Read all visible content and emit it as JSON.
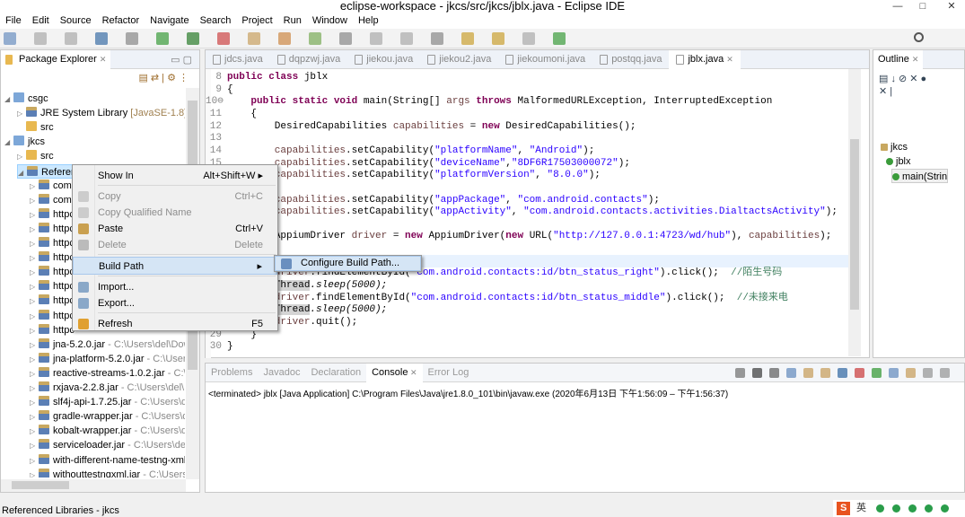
{
  "window": {
    "title": "eclipse-workspace - jkcs/src/jkcs/jblx.java - Eclipse IDE",
    "minimize": "—",
    "maximize": "□",
    "close": "✕"
  },
  "menu": [
    "File",
    "Edit",
    "Source",
    "Refactor",
    "Navigate",
    "Search",
    "Project",
    "Run",
    "Window",
    "Help"
  ],
  "package_explorer": {
    "title": "Package Explorer",
    "close": "✕",
    "tree": [
      {
        "label": "csgc",
        "indent": 0,
        "twisty": "◢",
        "icon": "project"
      },
      {
        "label": "JRE System Library",
        "decoration": " [JavaSE-1.8]",
        "indent": 1,
        "twisty": "▷",
        "icon": "library"
      },
      {
        "label": "src",
        "indent": 1,
        "twisty": "",
        "icon": "folder"
      },
      {
        "label": "jkcs",
        "indent": 0,
        "twisty": "◢",
        "icon": "project"
      },
      {
        "label": "src",
        "indent": 1,
        "twisty": "▷",
        "icon": "folder"
      },
      {
        "label": "Referenced Libraries",
        "indent": 1,
        "twisty": "◢",
        "icon": "library",
        "selected": true
      },
      {
        "label": "comr",
        "indent": 2,
        "twisty": "▷",
        "icon": "jar"
      },
      {
        "label": "comr",
        "indent": 2,
        "twisty": "▷",
        "icon": "jar"
      },
      {
        "label": "httpc",
        "indent": 2,
        "twisty": "▷",
        "icon": "jar"
      },
      {
        "label": "httpc",
        "indent": 2,
        "twisty": "▷",
        "icon": "jar"
      },
      {
        "label": "httpc",
        "indent": 2,
        "twisty": "▷",
        "icon": "jar"
      },
      {
        "label": "httpc",
        "indent": 2,
        "twisty": "▷",
        "icon": "jar"
      },
      {
        "label": "httpc",
        "indent": 2,
        "twisty": "▷",
        "icon": "jar"
      },
      {
        "label": "httpc",
        "indent": 2,
        "twisty": "▷",
        "icon": "jar"
      },
      {
        "label": "httpc",
        "indent": 2,
        "twisty": "▷",
        "icon": "jar"
      },
      {
        "label": "httpc",
        "indent": 2,
        "twisty": "▷",
        "icon": "jar"
      },
      {
        "label": "httpc",
        "indent": 2,
        "twisty": "▷",
        "icon": "jar"
      },
      {
        "label": "jna-5.2.0.jar",
        "path": " - C:\\Users\\del\\Down",
        "indent": 2,
        "twisty": "▷",
        "icon": "jar"
      },
      {
        "label": "jna-platform-5.2.0.jar",
        "path": " - C:\\Users\\",
        "indent": 2,
        "twisty": "▷",
        "icon": "jar"
      },
      {
        "label": "reactive-streams-1.0.2.jar",
        "path": " - C:\\Us",
        "indent": 2,
        "twisty": "▷",
        "icon": "jar"
      },
      {
        "label": "rxjava-2.2.8.jar",
        "path": " - C:\\Users\\del\\Dc",
        "indent": 2,
        "twisty": "▷",
        "icon": "jar"
      },
      {
        "label": "slf4j-api-1.7.25.jar",
        "path": " - C:\\Users\\del",
        "indent": 2,
        "twisty": "▷",
        "icon": "jar"
      },
      {
        "label": "gradle-wrapper.jar",
        "path": " - C:\\Users\\de",
        "indent": 2,
        "twisty": "▷",
        "icon": "jar"
      },
      {
        "label": "kobalt-wrapper.jar",
        "path": " - C:\\Users\\de",
        "indent": 2,
        "twisty": "▷",
        "icon": "jar"
      },
      {
        "label": "serviceloader.jar",
        "path": " - C:\\Users\\del\\",
        "indent": 2,
        "twisty": "▷",
        "icon": "jar"
      },
      {
        "label": "with-different-name-testng-xml.ja",
        "indent": 2,
        "twisty": "▷",
        "icon": "jar"
      },
      {
        "label": "withouttestngxml.jar",
        "path": " - C:\\Users\\c",
        "indent": 2,
        "twisty": "▷",
        "icon": "jar"
      },
      {
        "label": "withtestngxml.jar",
        "path": " - C:\\Users\\del\\",
        "indent": 2,
        "twisty": "▷",
        "icon": "jar"
      }
    ]
  },
  "editor": {
    "tabs": [
      {
        "label": "jdcs.java"
      },
      {
        "label": "dqpzwj.java"
      },
      {
        "label": "jiekou.java"
      },
      {
        "label": "jiekou2.java"
      },
      {
        "label": "jiekoumoni.java"
      },
      {
        "label": "postqq.java"
      },
      {
        "label": "jblx.java",
        "active": true
      }
    ],
    "lines": [
      {
        "n": "8",
        "t": [
          [
            "kw",
            "public class "
          ],
          [
            "",
            "jblx"
          ]
        ]
      },
      {
        "n": "9",
        "t": [
          [
            "",
            "{"
          ]
        ]
      },
      {
        "n": "10⊖",
        "t": [
          [
            "",
            "    "
          ],
          [
            "kw",
            "public static void "
          ],
          [
            "",
            "main(String[] "
          ],
          [
            "var",
            "args"
          ],
          [
            "",
            " "
          ],
          [
            "kw",
            "throws "
          ],
          [
            "",
            "MalformedURLException, InterruptedException"
          ]
        ]
      },
      {
        "n": "11",
        "t": [
          [
            "",
            "    {"
          ]
        ]
      },
      {
        "n": "12",
        "t": [
          [
            "",
            "        DesiredCapabilities "
          ],
          [
            "var",
            "capabilities"
          ],
          [
            "",
            " = "
          ],
          [
            "kw",
            "new "
          ],
          [
            "",
            "DesiredCapabilities();"
          ]
        ]
      },
      {
        "n": "13",
        "t": []
      },
      {
        "n": "14",
        "t": [
          [
            "var",
            "        capabilities"
          ],
          [
            "",
            ".setCapability("
          ],
          [
            "str",
            "\"platformName\""
          ],
          [
            "",
            ", "
          ],
          [
            "str",
            "\"Android\""
          ],
          [
            "",
            ");"
          ]
        ]
      },
      {
        "n": "15",
        "t": [
          [
            "var",
            "        capabilities"
          ],
          [
            "",
            ".setCapability("
          ],
          [
            "str",
            "\"deviceName\""
          ],
          [
            "",
            ","
          ],
          [
            "str",
            "\"8DF6R17503000072\""
          ],
          [
            "",
            ");"
          ]
        ]
      },
      {
        "n": "16",
        "t": [
          [
            "var",
            "        capabilities"
          ],
          [
            "",
            ".setCapability("
          ],
          [
            "str",
            "\"platformVersion\""
          ],
          [
            "",
            ", "
          ],
          [
            "str",
            "\"8.0.0\""
          ],
          [
            "",
            ");"
          ]
        ]
      },
      {
        "n": "17",
        "t": []
      },
      {
        "n": "18",
        "t": [
          [
            "var",
            "        capabilities"
          ],
          [
            "",
            ".setCapability("
          ],
          [
            "str",
            "\"appPackage\""
          ],
          [
            "",
            ", "
          ],
          [
            "str",
            "\"com.android.contacts\""
          ],
          [
            "",
            ");"
          ]
        ]
      },
      {
        "n": "19",
        "t": [
          [
            "var",
            "        capabilities"
          ],
          [
            "",
            ".setCapability("
          ],
          [
            "str",
            "\"appActivity\""
          ],
          [
            "",
            ", "
          ],
          [
            "str",
            "\"com.android.contacts.activities.DialtactsActivity\""
          ],
          [
            "",
            ");"
          ]
        ]
      },
      {
        "n": "20",
        "t": []
      },
      {
        "n": "21",
        "t": [
          [
            "",
            "        AppiumDriver "
          ],
          [
            "var",
            "driver"
          ],
          [
            "",
            " = "
          ],
          [
            "kw",
            "new "
          ],
          [
            "",
            "AppiumDriver("
          ],
          [
            "kw",
            "new "
          ],
          [
            "",
            "URL("
          ],
          [
            "str",
            "\"http://127.0.0.1:4723/wd/hub\""
          ],
          [
            "",
            "), "
          ],
          [
            "var",
            "capabilities"
          ],
          [
            "",
            ");"
          ]
        ]
      },
      {
        "n": "22",
        "t": []
      },
      {
        "n": "23",
        "t": [],
        "current": true
      },
      {
        "n": "24",
        "t": [
          [
            "var",
            "        driver"
          ],
          [
            "",
            ".findElementById("
          ],
          [
            "str",
            "\"com.android.contacts:id/btn_status_right\""
          ],
          [
            "",
            ").click();  "
          ],
          [
            "cm",
            "//陌生号码"
          ]
        ]
      },
      {
        "n": "25",
        "t": [
          [
            "hl",
            "        Thread"
          ],
          [
            "",
            ".sleep(5000);"
          ]
        ]
      },
      {
        "n": "26",
        "t": [
          [
            "var",
            "        driver"
          ],
          [
            "",
            ".findElementById("
          ],
          [
            "str",
            "\"com.android.contacts:id/btn_status_middle\""
          ],
          [
            "",
            ").click();  "
          ],
          [
            "cm",
            "//未接来电"
          ]
        ]
      },
      {
        "n": "27",
        "t": [
          [
            "hl",
            "        Thread"
          ],
          [
            "",
            ".sleep(5000);"
          ]
        ]
      },
      {
        "n": "28",
        "t": [
          [
            "var",
            "        driver"
          ],
          [
            "",
            ".quit();"
          ]
        ]
      },
      {
        "n": "29",
        "t": [
          [
            "",
            "    }"
          ]
        ]
      },
      {
        "n": "30",
        "t": [
          [
            "",
            "}"
          ]
        ]
      }
    ]
  },
  "outline": {
    "title": "Outline",
    "items": [
      {
        "label": "jkcs",
        "icon": "package"
      },
      {
        "label": "jblx",
        "icon": "class"
      },
      {
        "label": "main(Strin",
        "icon": "method"
      }
    ]
  },
  "console": {
    "tabs": [
      {
        "label": "Problems"
      },
      {
        "label": "Javadoc"
      },
      {
        "label": "Declaration"
      },
      {
        "label": "Console",
        "active": true
      },
      {
        "label": "Error Log"
      }
    ],
    "status": "<terminated> jblx [Java Application] C:\\Program Files\\Java\\jre1.8.0_101\\bin\\javaw.exe  (2020年6月13日 下午1:56:09 – 下午1:56:37)"
  },
  "context_menu": [
    {
      "label": "Show In",
      "shortcut": "Alt+Shift+W ▸"
    },
    {
      "sep": true
    },
    {
      "label": "Copy",
      "shortcut": "Ctrl+C",
      "disabled": true,
      "icon": "copy"
    },
    {
      "label": "Copy Qualified Name",
      "disabled": true,
      "icon": "copy-qualified"
    },
    {
      "label": "Paste",
      "shortcut": "Ctrl+V",
      "icon": "paste"
    },
    {
      "label": "Delete",
      "shortcut": "Delete",
      "disabled": true,
      "icon": "delete"
    },
    {
      "sep": true
    },
    {
      "label": "Build Path",
      "shortcut": "▸",
      "selected": true
    },
    {
      "sep": true
    },
    {
      "label": "Import...",
      "icon": "import"
    },
    {
      "label": "Export...",
      "icon": "export"
    },
    {
      "sep": true
    },
    {
      "label": "Refresh",
      "shortcut": "F5",
      "icon": "refresh"
    }
  ],
  "submenu": {
    "label": "Configure Build Path..."
  },
  "statusbar": {
    "text": "Referenced Libraries - jkcs"
  },
  "ime": {
    "logo": "S",
    "lang": "英"
  },
  "colors": {
    "selection": "#cce8ff",
    "menu_highlight": "#d5e5f5",
    "keyword": "#7f0055",
    "string": "#2a00ff"
  }
}
